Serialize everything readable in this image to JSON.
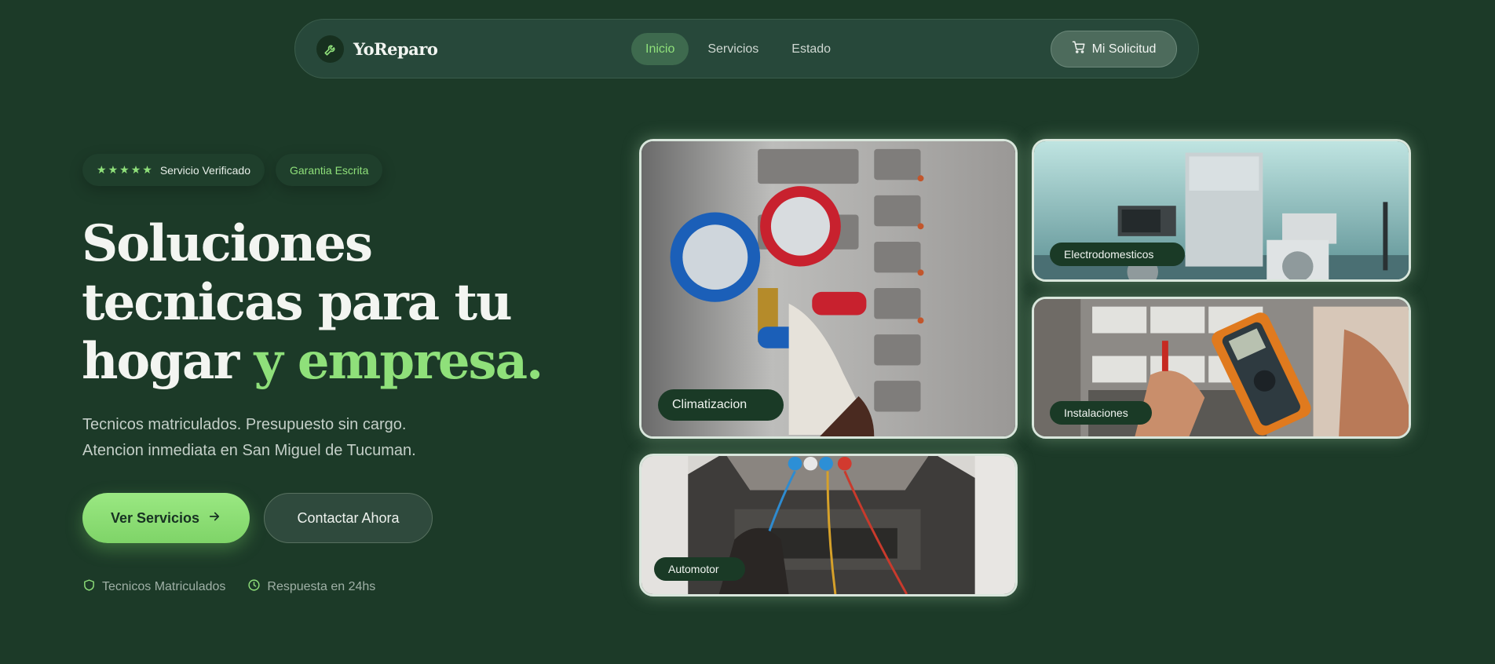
{
  "brand": {
    "name": "YoReparo",
    "logo_icon": "wrench-icon"
  },
  "nav": {
    "links": [
      {
        "label": "Inicio",
        "active": true
      },
      {
        "label": "Servicios",
        "active": false
      },
      {
        "label": "Estado",
        "active": false
      }
    ],
    "cart": {
      "label": "Mi Solicitud",
      "icon": "cart-icon"
    }
  },
  "hero": {
    "badges": {
      "verified": {
        "stars": 5,
        "label": "Servicio Verificado"
      },
      "guarantee": {
        "label": "Garantia Escrita"
      }
    },
    "headline_main": "Soluciones tecnicas para tu hogar ",
    "headline_accent": "y empresa.",
    "subtext_line1": "Tecnicos matriculados. Presupuesto sin cargo.",
    "subtext_line2": "Atencion inmediata en San Miguel de Tucuman.",
    "cta_primary": "Ver Servicios",
    "cta_secondary": "Contactar Ahora",
    "trust": [
      {
        "label": "Tecnicos Matriculados",
        "icon": "shield-icon"
      },
      {
        "label": "Respuesta en 24hs",
        "icon": "clock-icon"
      }
    ]
  },
  "cards": [
    {
      "label": "Climatizacion"
    },
    {
      "label": "Electrodomesticos"
    },
    {
      "label": "Instalaciones"
    },
    {
      "label": "Automotor"
    }
  ],
  "colors": {
    "background": "#1c3a28",
    "accent": "#8fe07a",
    "nav_bg": "#27483a",
    "card_border": "#d9e6dc"
  }
}
